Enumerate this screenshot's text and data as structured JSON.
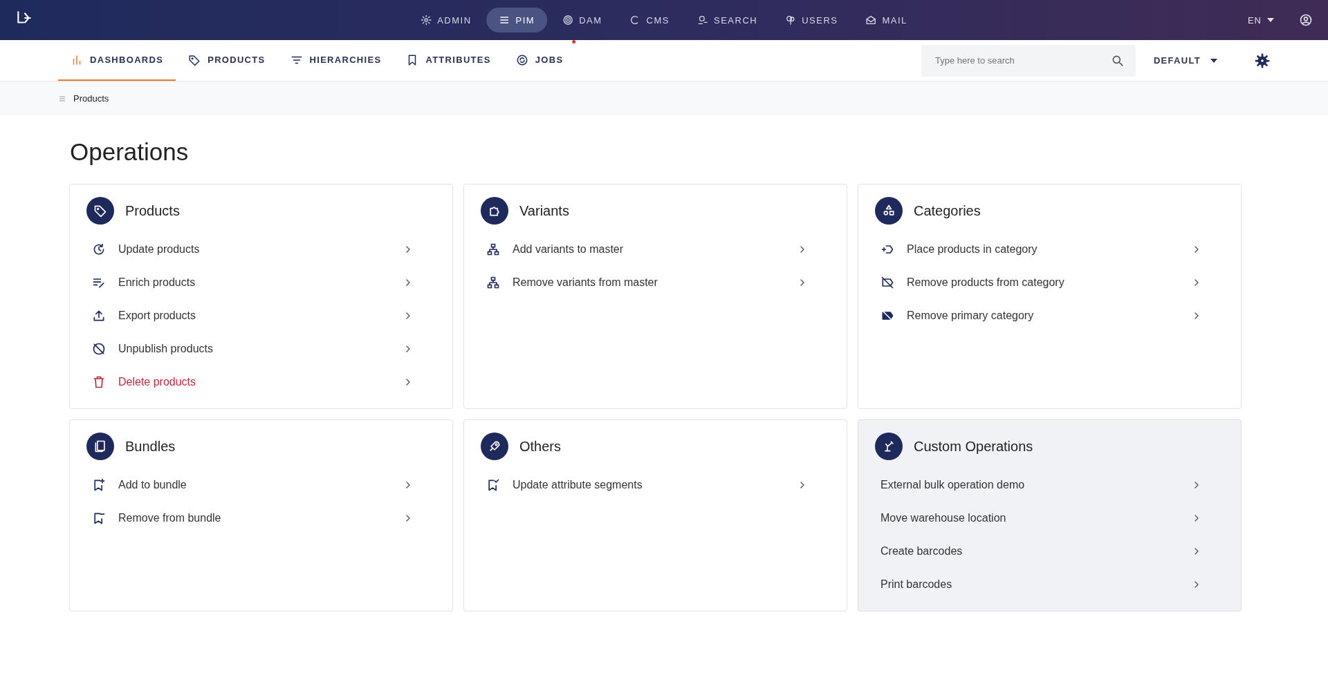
{
  "top_nav": {
    "items": [
      {
        "label": "ADMIN",
        "selected": false
      },
      {
        "label": "PIM",
        "selected": true
      },
      {
        "label": "DAM",
        "selected": false
      },
      {
        "label": "CMS",
        "selected": false
      },
      {
        "label": "SEARCH",
        "selected": false
      },
      {
        "label": "USERS",
        "selected": false
      },
      {
        "label": "MAIL",
        "selected": false
      }
    ],
    "language": "EN"
  },
  "sub_nav": {
    "tabs": [
      {
        "label": "DASHBOARDS",
        "selected": true
      },
      {
        "label": "PRODUCTS",
        "selected": false
      },
      {
        "label": "HIERARCHIES",
        "selected": false
      },
      {
        "label": "ATTRIBUTES",
        "selected": false
      },
      {
        "label": "JOBS",
        "selected": false
      }
    ],
    "search": {
      "placeholder": "Type here to search"
    },
    "channel": "DEFAULT"
  },
  "breadcrumb": "Products",
  "page_title": "Operations",
  "cards": [
    {
      "title": "Products",
      "highlighted": false,
      "items": [
        {
          "label": "Update products",
          "kind": "default"
        },
        {
          "label": "Enrich products",
          "kind": "default"
        },
        {
          "label": "Export products",
          "kind": "default"
        },
        {
          "label": "Unpublish products",
          "kind": "default"
        },
        {
          "label": "Delete products",
          "kind": "danger"
        }
      ]
    },
    {
      "title": "Variants",
      "highlighted": false,
      "items": [
        {
          "label": "Add variants to master",
          "kind": "default"
        },
        {
          "label": "Remove variants from master",
          "kind": "default"
        }
      ]
    },
    {
      "title": "Categories",
      "highlighted": false,
      "items": [
        {
          "label": "Place products in category",
          "kind": "default"
        },
        {
          "label": "Remove products from category",
          "kind": "default"
        },
        {
          "label": "Remove primary category",
          "kind": "default"
        }
      ]
    },
    {
      "title": "Bundles",
      "highlighted": false,
      "items": [
        {
          "label": "Add to bundle",
          "kind": "default"
        },
        {
          "label": "Remove from bundle",
          "kind": "default"
        }
      ]
    },
    {
      "title": "Others",
      "highlighted": false,
      "items": [
        {
          "label": "Update attribute segments",
          "kind": "default"
        }
      ]
    },
    {
      "title": "Custom Operations",
      "highlighted": true,
      "items": [
        {
          "label": "External bulk operation demo",
          "kind": "default"
        },
        {
          "label": "Move warehouse location",
          "kind": "default"
        },
        {
          "label": "Create barcodes",
          "kind": "default"
        },
        {
          "label": "Print barcodes",
          "kind": "default"
        }
      ]
    }
  ]
}
